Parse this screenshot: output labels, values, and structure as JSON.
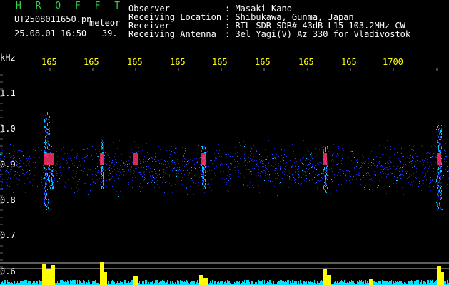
{
  "header": {
    "title": "H R O F F T",
    "filename": "UT2508011650.pn",
    "mode": "meteor",
    "date": "25.08.01 16:50",
    "count": "39."
  },
  "info": [
    {
      "label": "Observer",
      "value": ": Masaki Kano"
    },
    {
      "label": "Receiving Location",
      "value": ": Shibukawa, Gunma, Japan"
    },
    {
      "label": "Receiver",
      "value": ": RTL-SDR SDR# 43dB L15 103.2MHz CW"
    },
    {
      "label": "Receiving Antenna",
      "value": ": 3el Yagi(V) Az 330 for Vladivostok"
    }
  ],
  "time_ticks": [
    "165",
    "165",
    "165",
    "165",
    "165",
    "165",
    "165",
    "165",
    "1700"
  ],
  "y_axis": {
    "unit": "kHz",
    "labels": [
      "1.1",
      "1.0",
      "0.9",
      "0.8",
      "0.7",
      "0.6"
    ]
  },
  "colors": {
    "background": "#000000",
    "title": "#31d04a",
    "ticks": "#ffff00",
    "signal_strong": "#ff3060",
    "signal_mid": "#00d0ff",
    "signal_weak": "#2020c0",
    "level_bars": "#ffff00",
    "noise_floor": "#00e0ff"
  }
}
